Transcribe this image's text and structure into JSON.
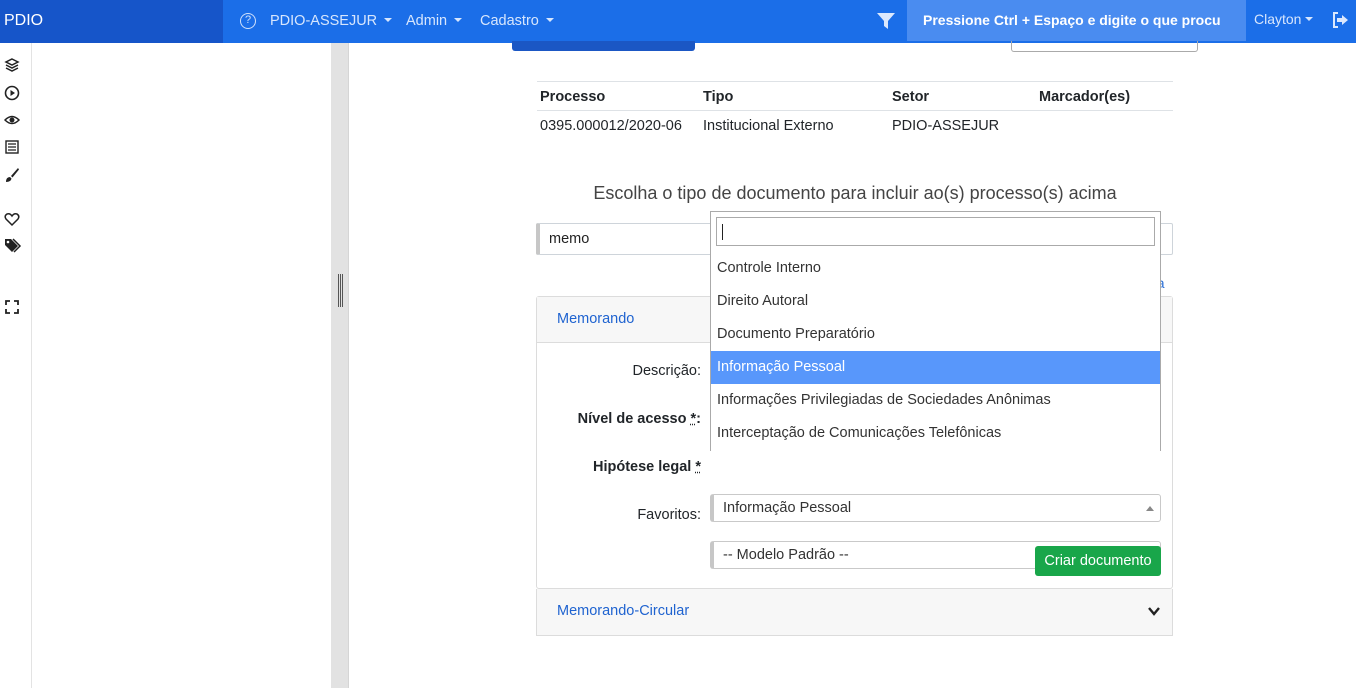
{
  "navbar": {
    "brand": "PDIO",
    "menus": [
      "PDIO-ASSEJUR",
      "Admin",
      "Cadastro"
    ],
    "help_icon": "question-circle-icon",
    "filter_icon": "funnel-icon",
    "search_placeholder": "Pressione Ctrl + Espaço e digite o que procu",
    "user": "Clayton",
    "logout_icon": "sign-out-icon",
    "color_primary": "#1b6ee8",
    "color_brand": "#1655c9"
  },
  "rail_icons": [
    "layers-icon",
    "play-circle-icon",
    "eye-icon",
    "list-alt-icon",
    "brush-icon",
    "heart-icon",
    "tags-icon",
    "expand-icon"
  ],
  "process_table": {
    "headers": [
      "Processo",
      "Tipo",
      "Setor",
      "Marcador(es)"
    ],
    "rows": [
      [
        "0395.000012/2020-06",
        "Institucional Externo",
        "PDIO-ASSEJUR",
        ""
      ]
    ]
  },
  "choose_title": "Escolha o tipo de documento para incluir ao(s) processo(s) acima",
  "filter_value": "memo",
  "partial_link": "a",
  "card": {
    "title": "Memorando",
    "labels": {
      "descricao": "Descrição:",
      "nivel": "Nível de acesso ",
      "hipotese": "Hipótese legal ",
      "favoritos": "Favoritos:",
      "required_mark": "*",
      "colon": ":"
    },
    "hipotese_value": "Informação Pessoal",
    "favoritos_value": "-- Modelo Padrão --",
    "create_button": "Criar documento"
  },
  "card2_title": "Memorando-Circular",
  "dropdown": {
    "search_value": "",
    "options": [
      "Controle Interno",
      "Direito Autoral",
      "Documento Preparatório",
      "Informação Pessoal",
      "Informações Privilegiadas de Sociedades Anônimas",
      "Interceptação de Comunicações Telefônicas"
    ],
    "selected": "Informação Pessoal",
    "highlight_color": "#5897fb"
  },
  "create_button_color": "#19a64a"
}
